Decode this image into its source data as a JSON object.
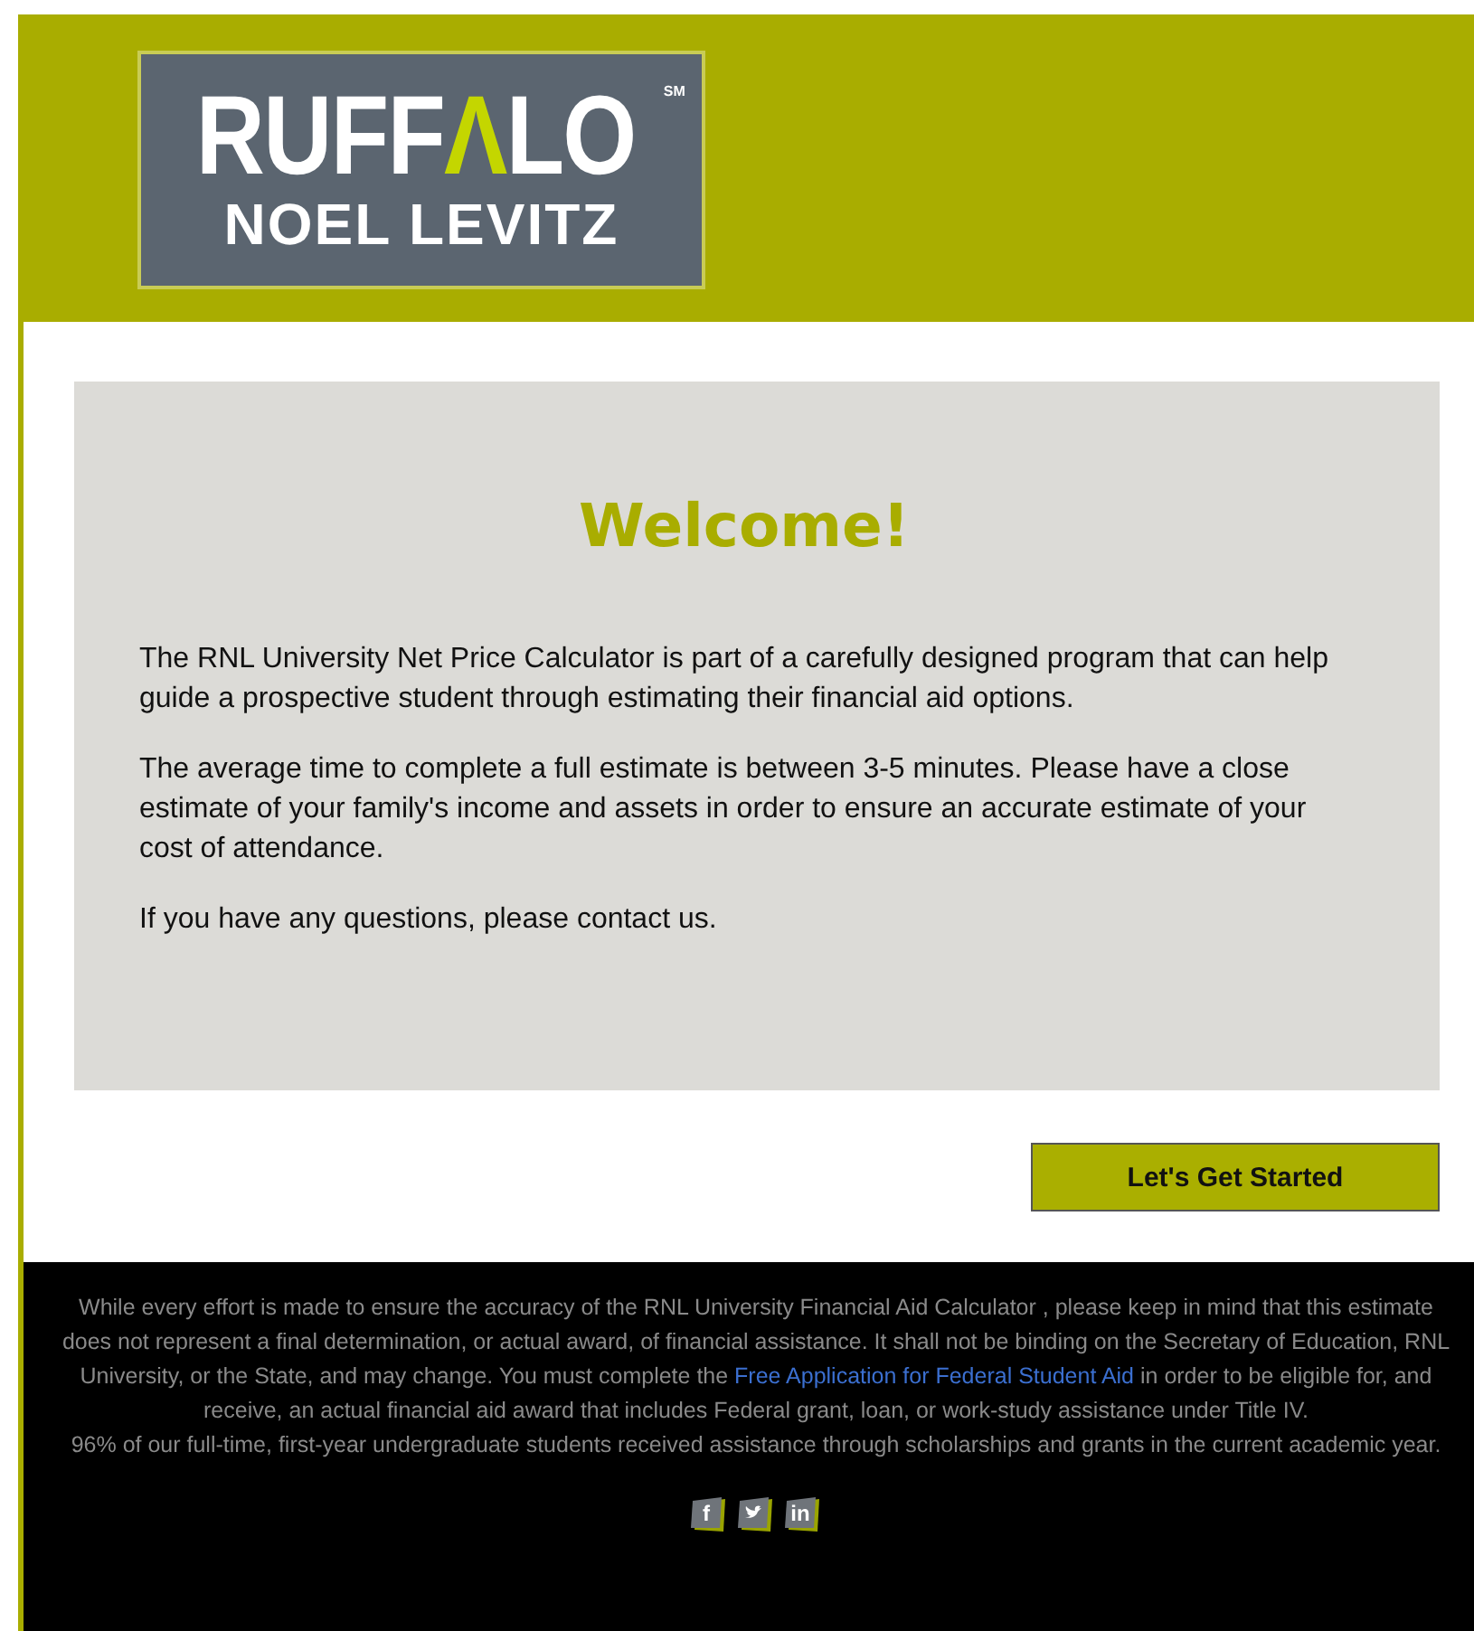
{
  "logo": {
    "name_parts": [
      {
        "text": "RUFF",
        "accent": false
      },
      {
        "text": "Λ",
        "accent": true
      },
      {
        "text": "LO",
        "accent": false
      }
    ],
    "mark": "SM",
    "subtitle": "NOEL LEVITZ"
  },
  "welcome": {
    "title": "Welcome!",
    "paragraphs": [
      "The RNL University Net Price Calculator is part of a carefully designed program that can help guide a prospective student through estimating their financial aid options.",
      "The average time to complete a full estimate is between 3-5 minutes. Please have a close estimate of your family's income and assets in order to ensure an accurate estimate of your cost of attendance.",
      "If you have any questions, please contact us."
    ]
  },
  "start_button": "Let's Get Started",
  "footer": {
    "disclaimer_before": "While every effort is made to ensure the accuracy of the RNL University Financial Aid Calculator , please keep in mind that this estimate does not represent a final determination, or actual award, of financial assistance. It shall not be binding on the Secretary of Education, RNL University, or the State, and may change. You must complete the",
    "link": "Free Application for Federal Student Aid",
    "disclaimer_after": "in order to be eligible for, and receive, an actual financial aid award that includes Federal grant, loan, or work-study assistance under Title IV.",
    "note": "96% of our full-time, first-year undergraduate students received assistance through scholarships and grants in the current academic year.",
    "social": [
      {
        "kind": "facebook",
        "label": "f"
      },
      {
        "kind": "twitter"
      },
      {
        "kind": "linkedin",
        "label": "in"
      }
    ]
  }
}
